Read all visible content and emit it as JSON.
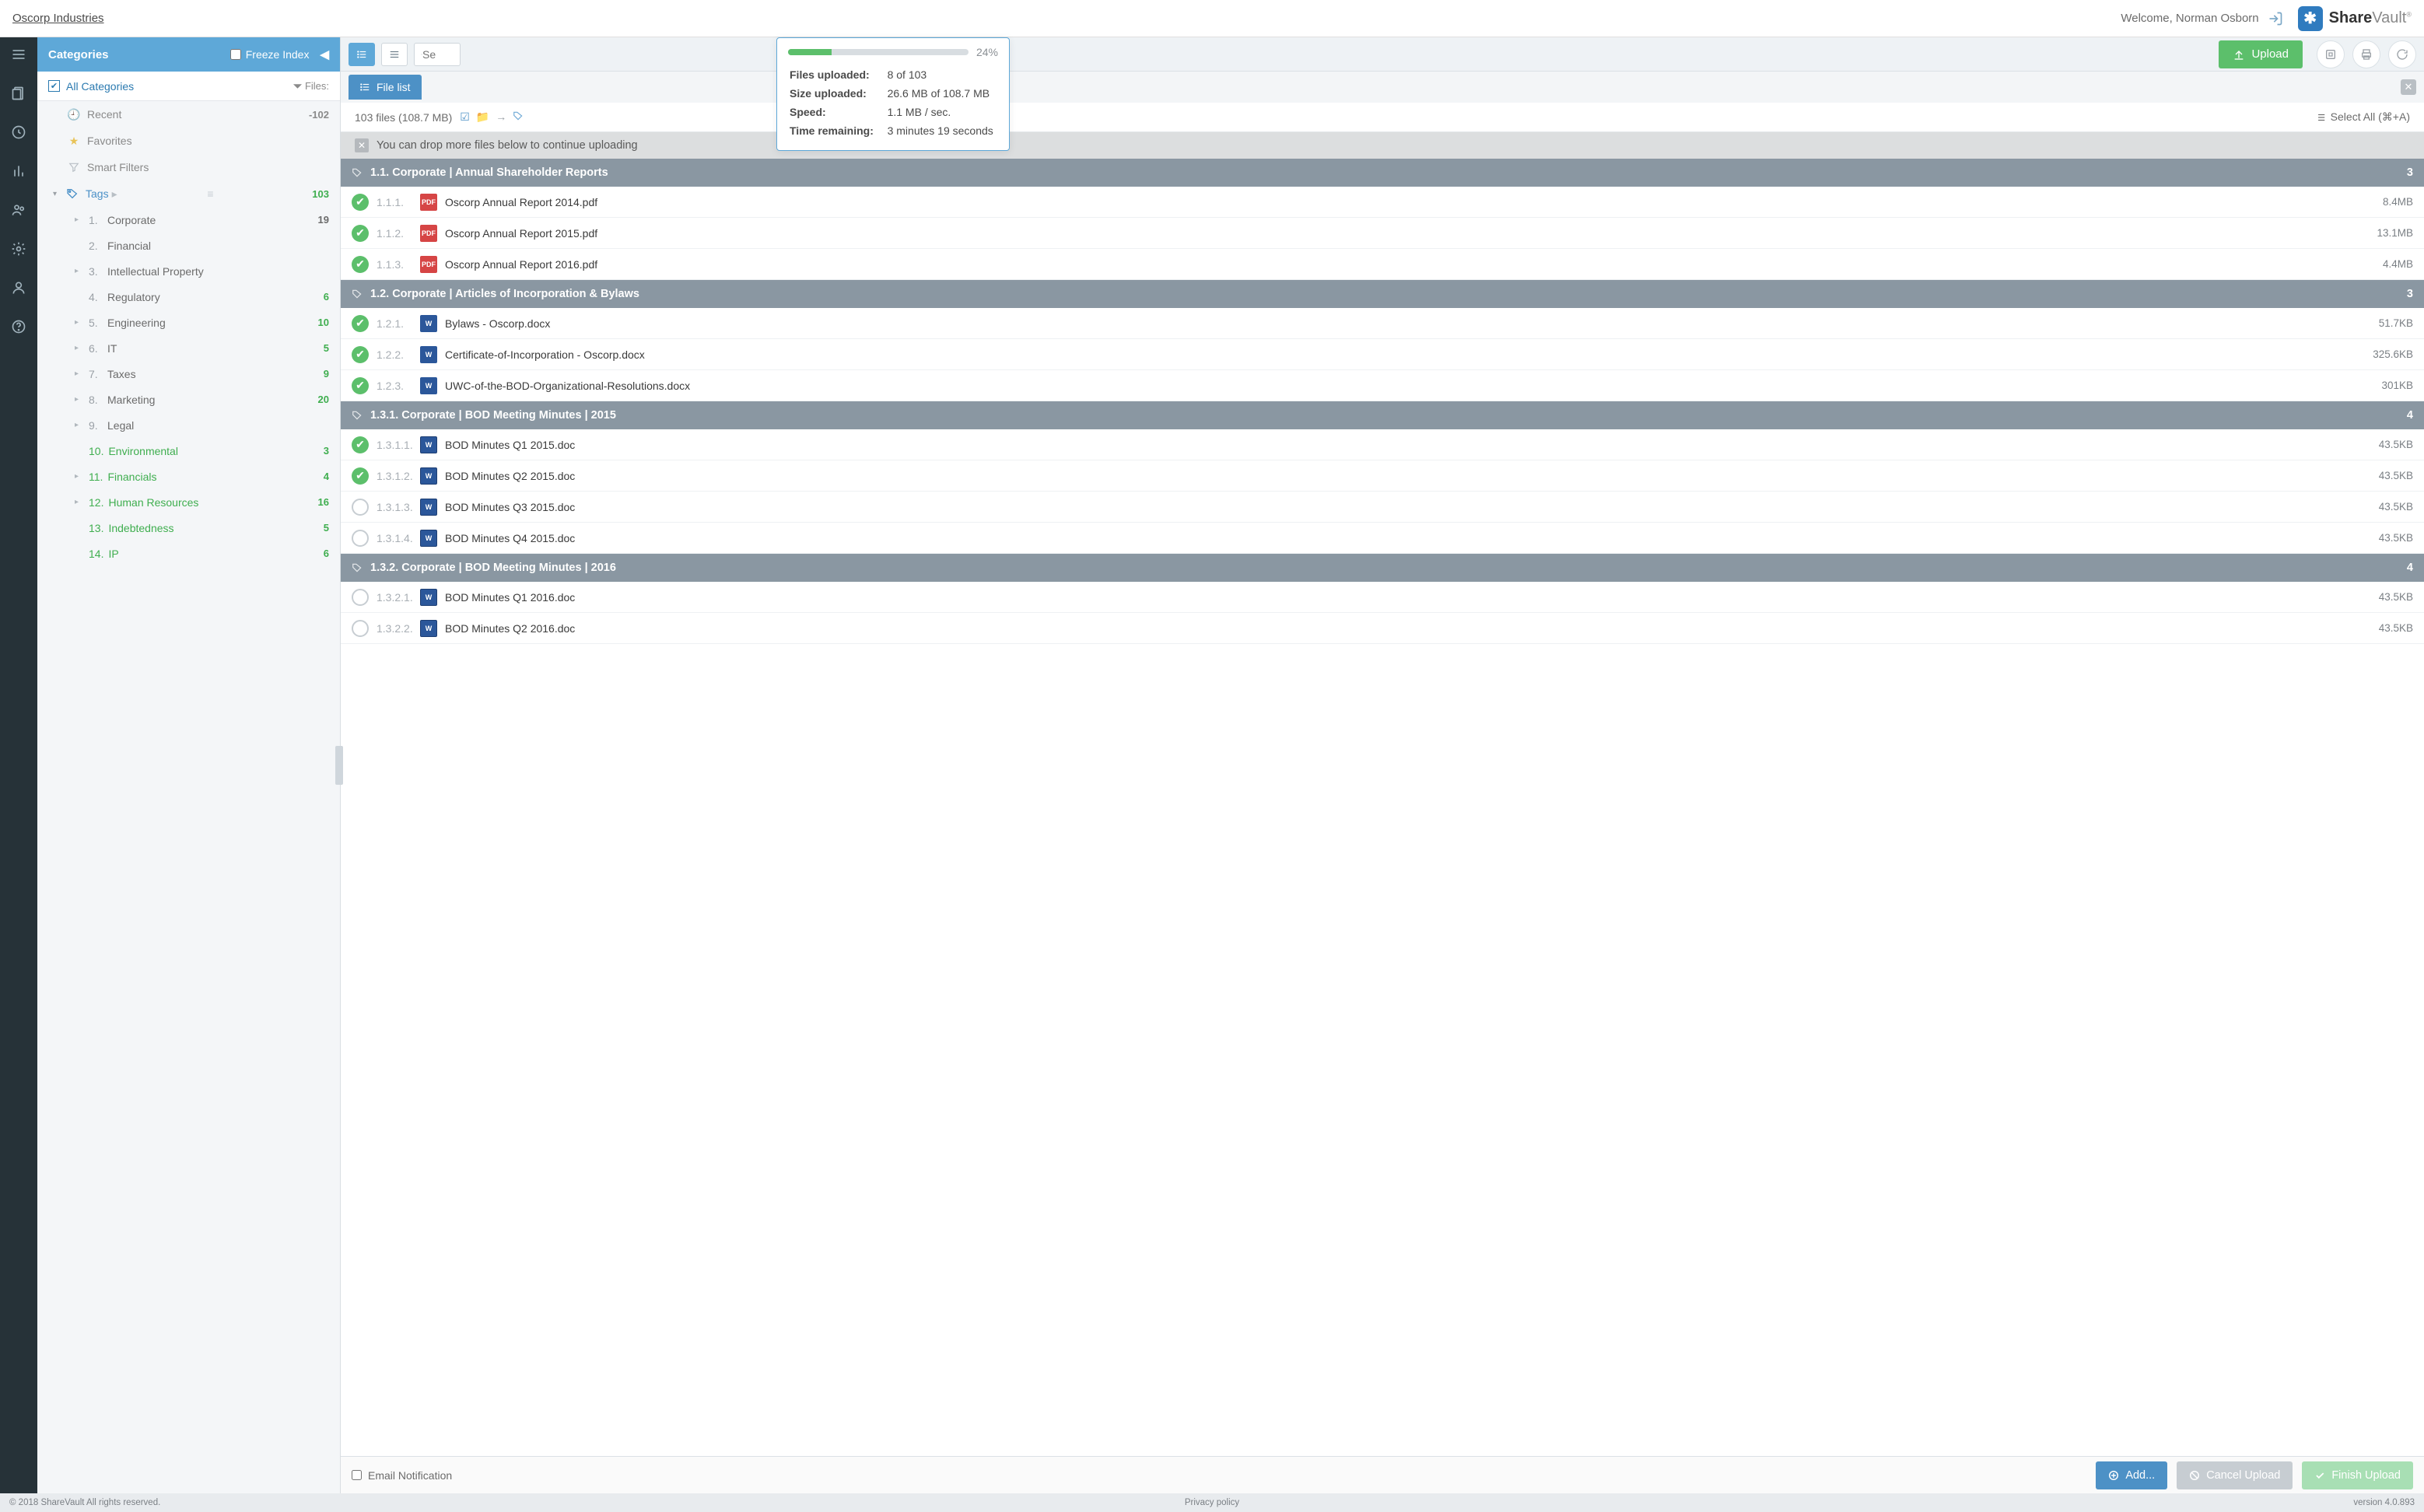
{
  "org": "Oscorp Industries",
  "welcome": "Welcome, Norman Osborn",
  "brand": {
    "name1": "Share",
    "name2": "Vault"
  },
  "sidebar": {
    "title": "Categories",
    "freeze": "Freeze Index",
    "all": "All Categories",
    "files_label": "Files:",
    "recent": {
      "label": "Recent",
      "count": "-102"
    },
    "favorites": "Favorites",
    "smart": "Smart Filters",
    "tags_label": "Tags",
    "tags_count": "103",
    "tags": [
      {
        "n": "1.",
        "label": "Corporate",
        "count": "19",
        "exp": true
      },
      {
        "n": "2.",
        "label": "Financial",
        "count": ""
      },
      {
        "n": "3.",
        "label": "Intellectual Property",
        "count": "",
        "exp": true
      },
      {
        "n": "4.",
        "label": "Regulatory",
        "count": "6",
        "green_cnt": true
      },
      {
        "n": "5.",
        "label": "Engineering",
        "count": "10",
        "exp": true,
        "green_cnt": true
      },
      {
        "n": "6.",
        "label": "IT",
        "count": "5",
        "exp": true,
        "green_cnt": true
      },
      {
        "n": "7.",
        "label": "Taxes",
        "count": "9",
        "exp": true,
        "green_cnt": true
      },
      {
        "n": "8.",
        "label": "Marketing",
        "count": "20",
        "exp": true,
        "green_cnt": true
      },
      {
        "n": "9.",
        "label": "Legal",
        "count": "",
        "exp": true
      },
      {
        "n": "10.",
        "label": "Environmental",
        "count": "3",
        "green": true,
        "green_cnt": true
      },
      {
        "n": "11.",
        "label": "Financials",
        "count": "4",
        "exp": true,
        "green": true,
        "green_cnt": true
      },
      {
        "n": "12.",
        "label": "Human Resources",
        "count": "16",
        "exp": true,
        "green": true,
        "green_cnt": true
      },
      {
        "n": "13.",
        "label": "Indebtedness",
        "count": "5",
        "green": true,
        "green_cnt": true
      },
      {
        "n": "14.",
        "label": "IP",
        "count": "6",
        "green": true,
        "green_cnt": true
      }
    ]
  },
  "toolbar": {
    "search_placeholder": "Se",
    "upload": "Upload"
  },
  "tab": {
    "label": "File list"
  },
  "meta": {
    "summary": "103 files (108.7 MB)",
    "select_all": "Select All (⌘+A)"
  },
  "drop_hint": "You can drop more files below to continue uploading",
  "sections": [
    {
      "title": "1.1. Corporate | Annual Shareholder Reports",
      "count": "3",
      "files": [
        {
          "idx": "1.1.1.",
          "name": "Oscorp Annual Report 2014.pdf",
          "size": "8.4MB",
          "type": "pdf",
          "done": true
        },
        {
          "idx": "1.1.2.",
          "name": "Oscorp Annual Report 2015.pdf",
          "size": "13.1MB",
          "type": "pdf",
          "done": true
        },
        {
          "idx": "1.1.3.",
          "name": "Oscorp Annual Report 2016.pdf",
          "size": "4.4MB",
          "type": "pdf",
          "done": true
        }
      ]
    },
    {
      "title": "1.2. Corporate | Articles of Incorporation & Bylaws",
      "count": "3",
      "files": [
        {
          "idx": "1.2.1.",
          "name": "Bylaws - Oscorp.docx",
          "size": "51.7KB",
          "type": "docx",
          "done": true
        },
        {
          "idx": "1.2.2.",
          "name": "Certificate-of-Incorporation - Oscorp.docx",
          "size": "325.6KB",
          "type": "docx",
          "done": true
        },
        {
          "idx": "1.2.3.",
          "name": "UWC-of-the-BOD-Organizational-Resolutions.docx",
          "size": "301KB",
          "type": "docx",
          "done": true
        }
      ]
    },
    {
      "title": "1.3.1. Corporate | BOD Meeting Minutes | 2015",
      "count": "4",
      "files": [
        {
          "idx": "1.3.1.1.",
          "name": "BOD Minutes Q1 2015.doc",
          "size": "43.5KB",
          "type": "doc",
          "done": true
        },
        {
          "idx": "1.3.1.2.",
          "name": "BOD Minutes Q2 2015.doc",
          "size": "43.5KB",
          "type": "doc",
          "done": true
        },
        {
          "idx": "1.3.1.3.",
          "name": "BOD Minutes Q3 2015.doc",
          "size": "43.5KB",
          "type": "doc",
          "done": false
        },
        {
          "idx": "1.3.1.4.",
          "name": "BOD Minutes Q4 2015.doc",
          "size": "43.5KB",
          "type": "doc",
          "done": false
        }
      ]
    },
    {
      "title": "1.3.2. Corporate | BOD Meeting Minutes | 2016",
      "count": "4",
      "files": [
        {
          "idx": "1.3.2.1.",
          "name": "BOD Minutes Q1 2016.doc",
          "size": "43.5KB",
          "type": "doc",
          "done": false
        },
        {
          "idx": "1.3.2.2.",
          "name": "BOD Minutes Q2 2016.doc",
          "size": "43.5KB",
          "type": "doc",
          "done": false
        }
      ]
    }
  ],
  "bottom": {
    "email": "Email Notification",
    "add": "Add...",
    "cancel": "Cancel Upload",
    "finish": "Finish Upload"
  },
  "footer": {
    "copy": "© 2018 ShareVault All rights reserved.",
    "privacy": "Privacy policy",
    "version": "version 4.0.893"
  },
  "popover": {
    "pct": "24%",
    "pct_fill": 24,
    "rows": [
      {
        "k": "Files uploaded:",
        "v": "8 of 103"
      },
      {
        "k": "Size uploaded:",
        "v": "26.6 MB of 108.7 MB"
      },
      {
        "k": "Speed:",
        "v": "1.1 MB / sec."
      },
      {
        "k": "Time remaining:",
        "v": "3 minutes 19 seconds"
      }
    ]
  }
}
